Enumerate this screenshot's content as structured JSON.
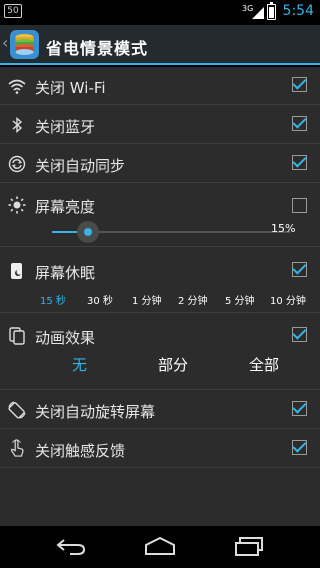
{
  "status_bar": {
    "badge": "50",
    "signal_label": "3G",
    "time": "5:54"
  },
  "action_bar": {
    "back_glyph": "‹",
    "title": "省电情景模式",
    "app_icon": "battery-stack-icon"
  },
  "settings": {
    "wifi": {
      "label": "关闭 Wi-Fi",
      "checked": true,
      "icon": "wifi-icon"
    },
    "bluetooth": {
      "label": "关闭蓝牙",
      "checked": true,
      "icon": "bluetooth-icon"
    },
    "sync": {
      "label": "关闭自动同步",
      "checked": true,
      "icon": "sync-icon"
    },
    "brightness": {
      "label": "屏幕亮度",
      "checked": false,
      "icon": "brightness-icon",
      "value_label": "15%",
      "level": 0.15
    },
    "sleep": {
      "label": "屏幕休眠",
      "checked": true,
      "icon": "screen-sleep-icon",
      "options": [
        "15 秒",
        "30 秒",
        "1 分钟",
        "2 分钟",
        "5 分钟",
        "10 分钟"
      ],
      "selected": "15 秒"
    },
    "animation": {
      "label": "动画效果",
      "checked": true,
      "icon": "animation-icon",
      "options": [
        "无",
        "部分",
        "全部"
      ],
      "selected": "无"
    },
    "rotation": {
      "label": "关闭自动旋转屏幕",
      "checked": true,
      "icon": "rotate-icon"
    },
    "haptic": {
      "label": "关闭触感反馈",
      "checked": true,
      "icon": "touch-feedback-icon"
    }
  },
  "nav_bar": {
    "back": "back-icon",
    "home": "home-icon",
    "recents": "recent-apps-icon"
  },
  "colors": {
    "accent": "#33b5e5",
    "background": "#2c2c2c",
    "action_bar": "#252a2e"
  }
}
